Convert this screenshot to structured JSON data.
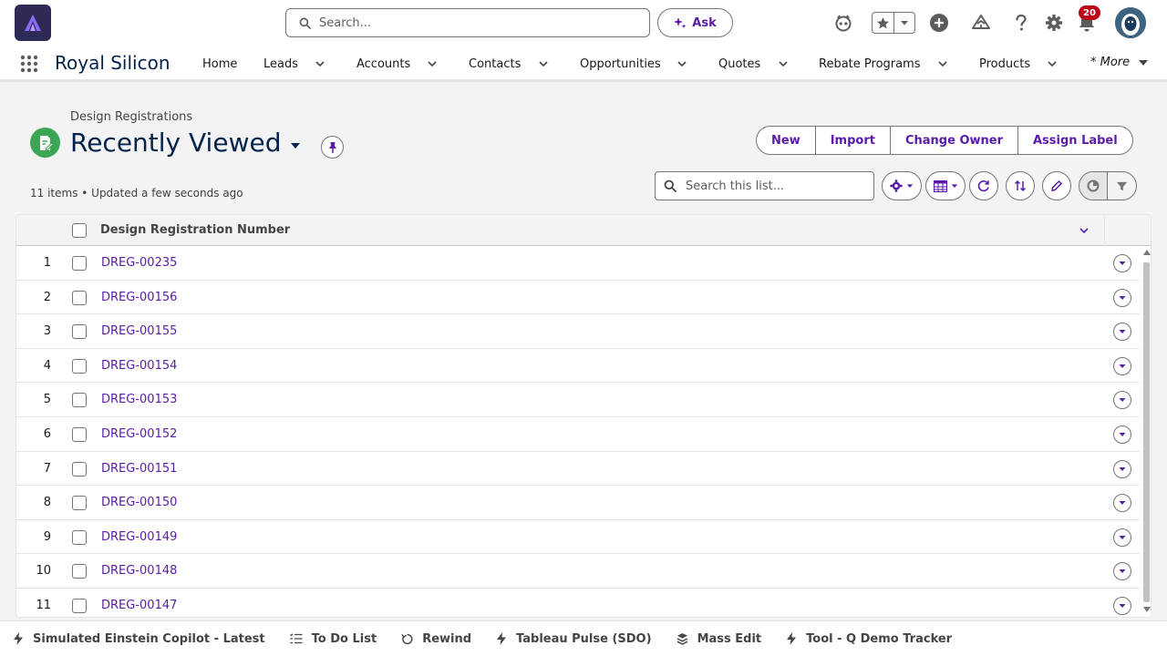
{
  "header": {
    "search_placeholder": "Search...",
    "ask_label": "Ask",
    "notification_count": "20"
  },
  "nav": {
    "app_name": "Royal Silicon",
    "items": [
      {
        "label": "Home",
        "has_menu": false
      },
      {
        "label": "Leads",
        "has_menu": true
      },
      {
        "label": "Accounts",
        "has_menu": true
      },
      {
        "label": "Contacts",
        "has_menu": true
      },
      {
        "label": "Opportunities",
        "has_menu": true
      },
      {
        "label": "Quotes",
        "has_menu": true
      },
      {
        "label": "Rebate Programs",
        "has_menu": true
      },
      {
        "label": "Products",
        "has_menu": true
      }
    ],
    "more_label": "* More"
  },
  "page": {
    "object_label": "Design Registrations",
    "view_title": "Recently Viewed",
    "meta": "11 items • Updated a few seconds ago",
    "actions": [
      "New",
      "Import",
      "Change Owner",
      "Assign Label"
    ],
    "list_search_placeholder": "Search this list..."
  },
  "table": {
    "column_header": "Design Registration Number",
    "rows": [
      {
        "num": "1",
        "id": "DREG-00235"
      },
      {
        "num": "2",
        "id": "DREG-00156"
      },
      {
        "num": "3",
        "id": "DREG-00155"
      },
      {
        "num": "4",
        "id": "DREG-00154"
      },
      {
        "num": "5",
        "id": "DREG-00153"
      },
      {
        "num": "6",
        "id": "DREG-00152"
      },
      {
        "num": "7",
        "id": "DREG-00151"
      },
      {
        "num": "8",
        "id": "DREG-00150"
      },
      {
        "num": "9",
        "id": "DREG-00149"
      },
      {
        "num": "10",
        "id": "DREG-00148"
      },
      {
        "num": "11",
        "id": "DREG-00147"
      }
    ]
  },
  "utility_bar": {
    "items": [
      {
        "label": "Simulated Einstein Copilot - Latest",
        "icon": "lightning-icon"
      },
      {
        "label": "To Do List",
        "icon": "checklist-icon"
      },
      {
        "label": "Rewind",
        "icon": "rewind-icon"
      },
      {
        "label": "Tableau Pulse (SDO)",
        "icon": "lightning-icon"
      },
      {
        "label": "Mass Edit",
        "icon": "layers-icon"
      },
      {
        "label": "Tool - Q Demo Tracker",
        "icon": "lightning-icon"
      }
    ]
  },
  "colors": {
    "brand_purple": "#5a1ba9",
    "title_navy": "#03234d",
    "object_icon_green": "#3ba755",
    "badge_red": "#ba0517"
  }
}
